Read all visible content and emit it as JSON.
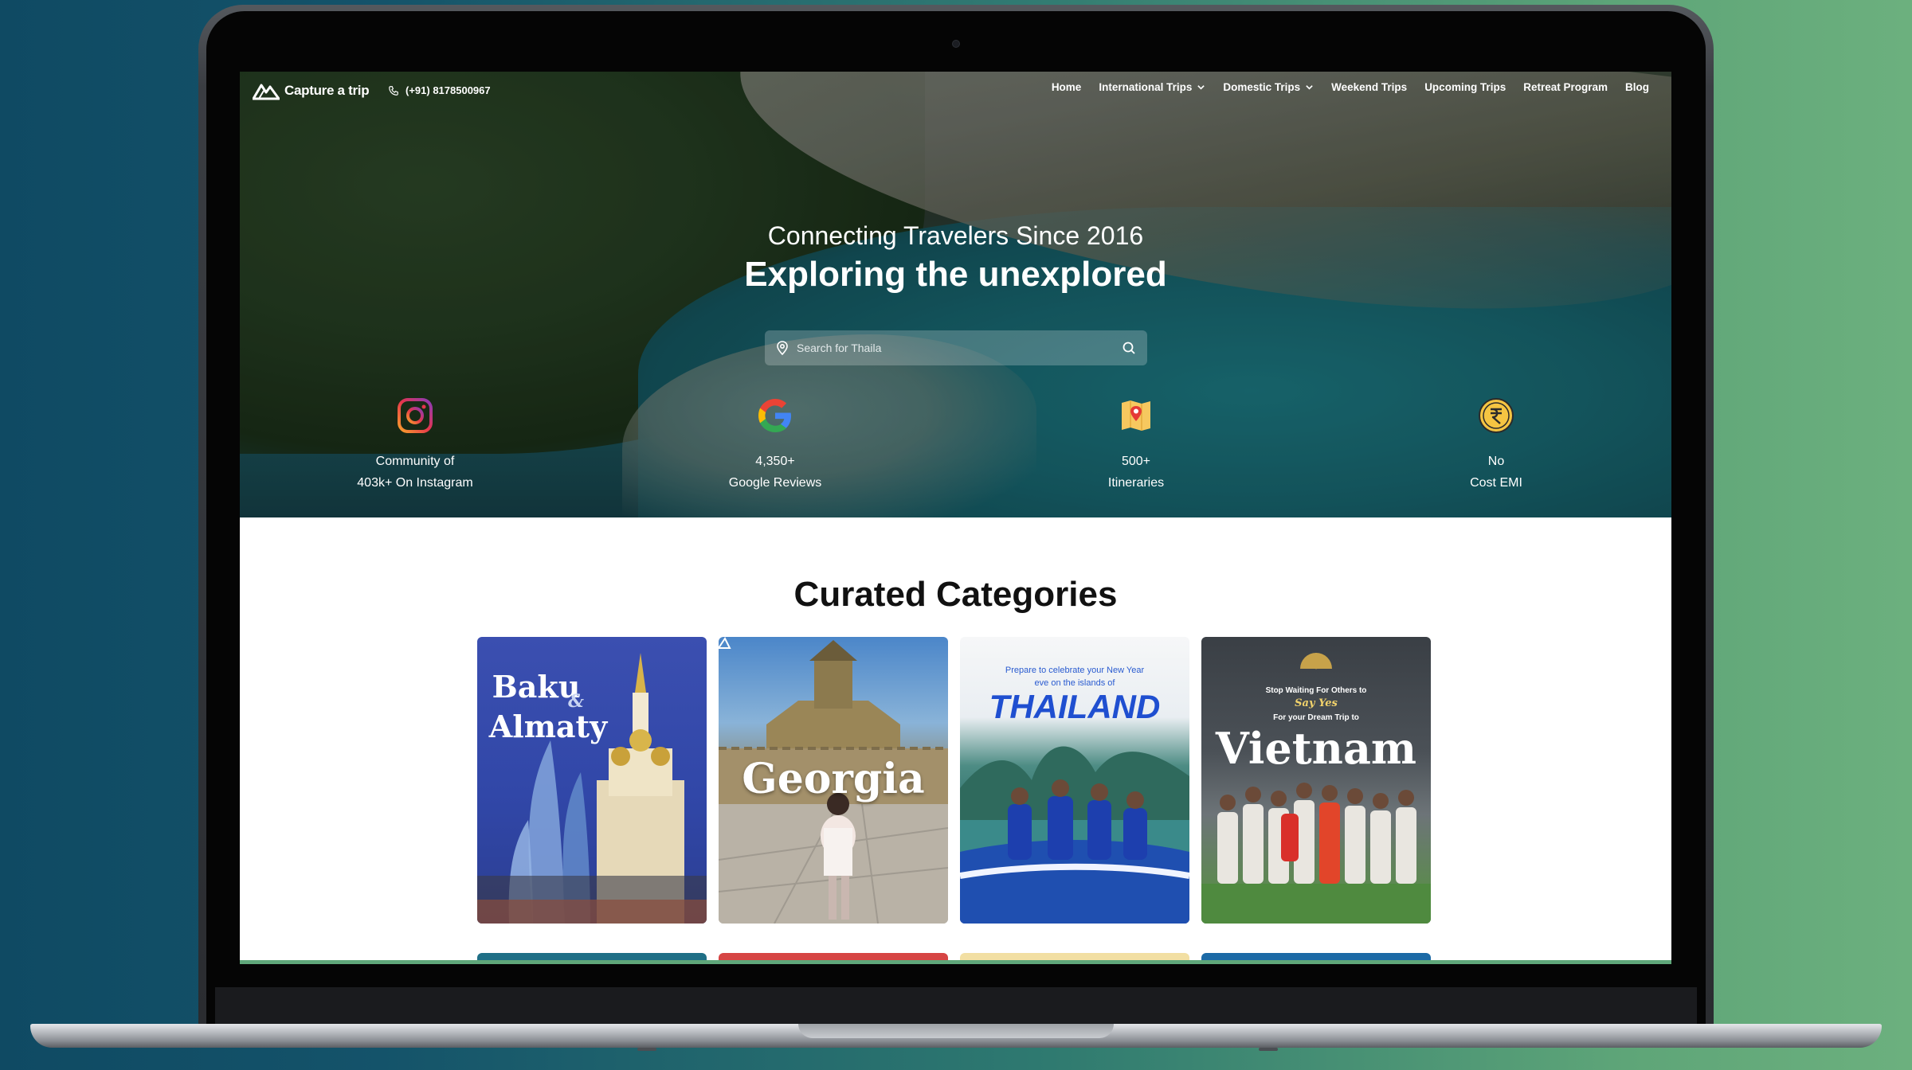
{
  "header": {
    "logo_text": "Capture a trip",
    "phone": "(+91) 8178500967"
  },
  "nav": {
    "items": [
      {
        "label": "Home",
        "dropdown": false
      },
      {
        "label": "International Trips",
        "dropdown": true
      },
      {
        "label": "Domestic Trips",
        "dropdown": true
      },
      {
        "label": "Weekend Trips",
        "dropdown": false
      },
      {
        "label": "Upcoming Trips",
        "dropdown": false
      },
      {
        "label": "Retreat Program",
        "dropdown": false
      },
      {
        "label": "Blog",
        "dropdown": false
      }
    ]
  },
  "hero": {
    "subtitle": "Connecting Travelers Since 2016",
    "title": "Exploring the unexplored",
    "search_placeholder": "Search for Thaila"
  },
  "stats": [
    {
      "icon": "instagram-icon",
      "line1": "Community of",
      "line2": "403k+ On Instagram"
    },
    {
      "icon": "google-icon",
      "line1": "4,350+",
      "line2": "Google Reviews"
    },
    {
      "icon": "map-pin-icon",
      "line1": "500+",
      "line2": "Itineraries"
    },
    {
      "icon": "rupee-coin-icon",
      "line1": "No",
      "line2": "Cost EMI"
    }
  ],
  "categories": {
    "title": "Curated Categories",
    "cards": [
      {
        "name": "baku-almaty",
        "line1": "Baku",
        "amp": "&",
        "line2": "Almaty"
      },
      {
        "name": "georgia",
        "caption": "Georgia"
      },
      {
        "name": "thailand",
        "top": "Prepare to celebrate your New Year",
        "top2": "eve on the islands of",
        "caption": "THAILAND"
      },
      {
        "name": "vietnam",
        "top": "Stop Waiting For Others to",
        "top2": "Say Yes",
        "top3": "For your Dream Trip to",
        "caption": "Vietnam"
      }
    ]
  },
  "colors": {
    "bg_left": "#0f4a63",
    "bg_right": "#6cb07e",
    "hero_text": "#ffffff",
    "title_text": "#111111"
  }
}
